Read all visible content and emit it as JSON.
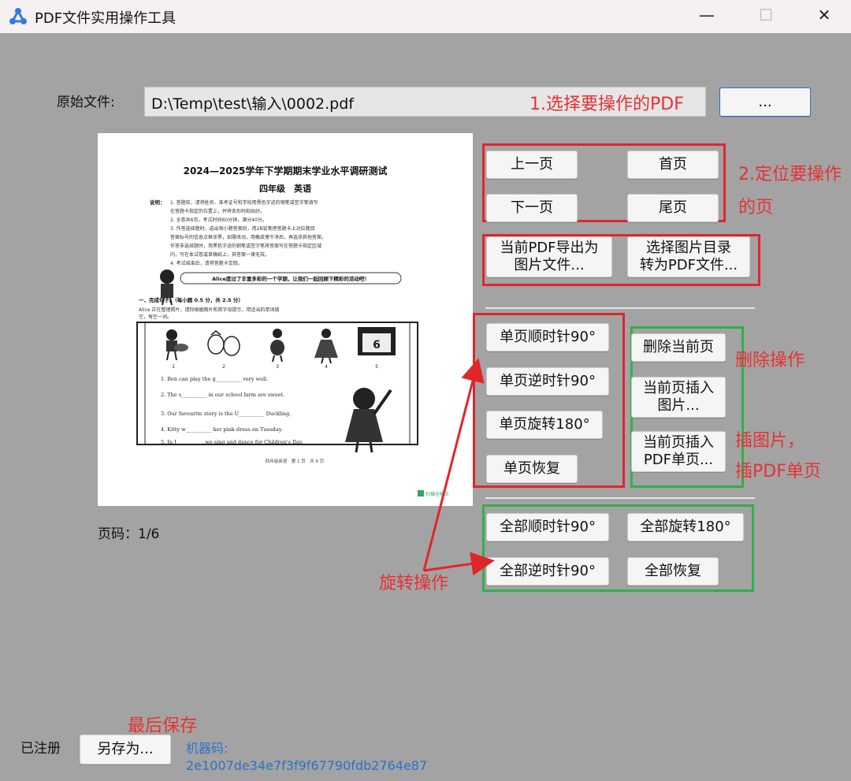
{
  "window": {
    "title": "PDF文件实用操作工具",
    "minimize_glyph": "—",
    "maximize_glyph": "☐",
    "close_glyph": "✕"
  },
  "file": {
    "label": "原始文件:",
    "path": "D:\\Temp\\test\\输入\\0002.pdf",
    "browse_label": "..."
  },
  "preview": {
    "title": "2024—2025学年下学期期末学业水平调研测试",
    "subtitle": "四年级　英语",
    "instructions_head": "说明：",
    "instructions_lines": [
      "1. 答题前，请将姓名、准考证号和学校用黑色字迹的钢笔或签字笔填写",
      "在答题卡指定的位置上，并将条形码粘贴好。",
      "2. 全卷共6页，考试时间60分钟，满分40分。",
      "3. 作答选择题时，选出每小题答案后，用2B铅笔把答题卡上对应题目",
      "答案标号的信息点框涂黑，如需改动，用橡皮擦干净后，再选涂其他答案。",
      "作答非选择题时，用黑色字迹的钢笔或签字笔将答案写在答题卡指定区域",
      "内，写在本试卷或草稿纸上，其答案一律无效。",
      "4. 考试结束后，请将答题卡交回。"
    ],
    "banner": "Alice度过了丰富多彩的一个学期，让我们一起回顾下精彩的活动吧！",
    "section_head": "一、完成句子。（每小题 0.5 分，共 2.5 分）",
    "section_desc_lines": [
      "Alice 正在整理照片，请你根据图片和首字母提示，用适当的单词填",
      "空，每空一词。"
    ],
    "picture_numbers": [
      "1",
      "2",
      "3",
      "4",
      "5"
    ],
    "questions": [
      "1. Ben can play the g__________ very well.",
      "2. The s__________ in our school farm are sweet.",
      "3. Our favourite story is the U__________ Duckling.",
      "4. Kitty w__________ her pink dress on Tuesday.",
      "5. In J__________, we sing and dance for Children's Day."
    ],
    "footer": "四年级英语　第 1 页　共 6 页",
    "stamp": "扫描全能王"
  },
  "page_indicator": "页码：1/6",
  "nav_buttons": {
    "prev": "上一页",
    "first": "首页",
    "next": "下一页",
    "last": "尾页"
  },
  "export_buttons": {
    "export_line1": "当前PDF导出为",
    "export_line2": "图片文件...",
    "images_line1": "选择图片目录",
    "images_line2": "转为PDF文件..."
  },
  "single_rotate": {
    "cw": "单页顺时针90°",
    "ccw": "单页逆时针90°",
    "r180": "单页旋转180°",
    "restore": "单页恢复"
  },
  "page_edit": {
    "delete": "删除当前页",
    "insert_img_line1": "当前页插入",
    "insert_img_line2": "图片...",
    "insert_pdf_line1": "当前页插入",
    "insert_pdf_line2": "PDF单页..."
  },
  "all_rotate": {
    "cw": "全部顺时针90°",
    "r180": "全部旋转180°",
    "ccw": "全部逆时针90°",
    "restore": "全部恢复"
  },
  "footer": {
    "registered": "已注册",
    "save_as": "另存为...",
    "machine_label": "机器码:",
    "machine_code": "2e1007de34e7f3f9f67790fdb2764e87"
  },
  "annotations": {
    "step1": "1.选择要操作的PDF",
    "step2_line1": "2.定位要操作",
    "step2_line2": "的页",
    "delete_op": "删除操作",
    "insert_line1": "插图片，",
    "insert_line2": "插PDF单页",
    "rotate_op": "旋转操作",
    "save_last": "最后保存"
  },
  "colors": {
    "background": "#a3a3a3",
    "annotation_red": "#e0262c",
    "annotation_green": "#2fb14a",
    "link_blue": "#2b72c8"
  }
}
